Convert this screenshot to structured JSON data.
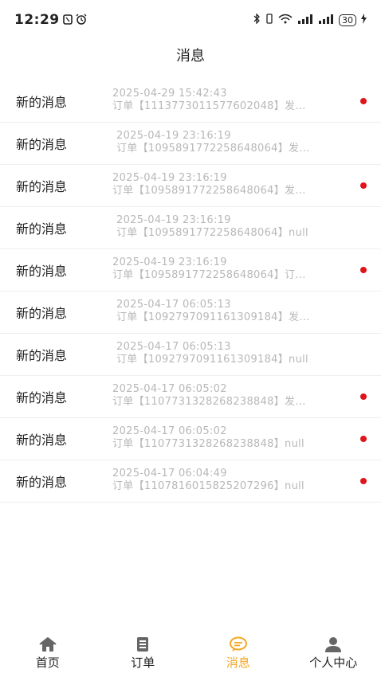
{
  "status_bar": {
    "time": "12:29",
    "battery": "30"
  },
  "header": {
    "title": "消息"
  },
  "messages": [
    {
      "title": "新的消息",
      "date": "2025-04-29 15:42:43",
      "summary": "订单【1113773011577602048】发...",
      "unread": true
    },
    {
      "title": "新的消息",
      "date": "2025-04-19 23:16:19",
      "summary": "订单【1095891772258648064】发...",
      "unread": false
    },
    {
      "title": "新的消息",
      "date": "2025-04-19 23:16:19",
      "summary": "订单【1095891772258648064】发...",
      "unread": true
    },
    {
      "title": "新的消息",
      "date": "2025-04-19 23:16:19",
      "summary": "订单【1095891772258648064】null",
      "unread": false
    },
    {
      "title": "新的消息",
      "date": "2025-04-19 23:16:19",
      "summary": "订单【1095891772258648064】订...",
      "unread": true
    },
    {
      "title": "新的消息",
      "date": "2025-04-17 06:05:13",
      "summary": "订单【1092797091161309184】发...",
      "unread": false
    },
    {
      "title": "新的消息",
      "date": "2025-04-17 06:05:13",
      "summary": "订单【1092797091161309184】null",
      "unread": false
    },
    {
      "title": "新的消息",
      "date": "2025-04-17 06:05:02",
      "summary": "订单【1107731328268238848】发...",
      "unread": true
    },
    {
      "title": "新的消息",
      "date": "2025-04-17 06:05:02",
      "summary": "订单【1107731328268238848】null",
      "unread": true
    },
    {
      "title": "新的消息",
      "date": "2025-04-17 06:04:49",
      "summary": "订单【1107816015825207296】null",
      "unread": true
    }
  ],
  "tabs": [
    {
      "label": "首页",
      "icon": "home-icon",
      "active": false
    },
    {
      "label": "订单",
      "icon": "order-icon",
      "active": false
    },
    {
      "label": "消息",
      "icon": "message-icon",
      "active": true
    },
    {
      "label": "个人中心",
      "icon": "user-icon",
      "active": false
    }
  ],
  "colors": {
    "accent": "#f5a623",
    "unread_dot": "#e0141b",
    "meta_text": "#b8b8b8"
  }
}
